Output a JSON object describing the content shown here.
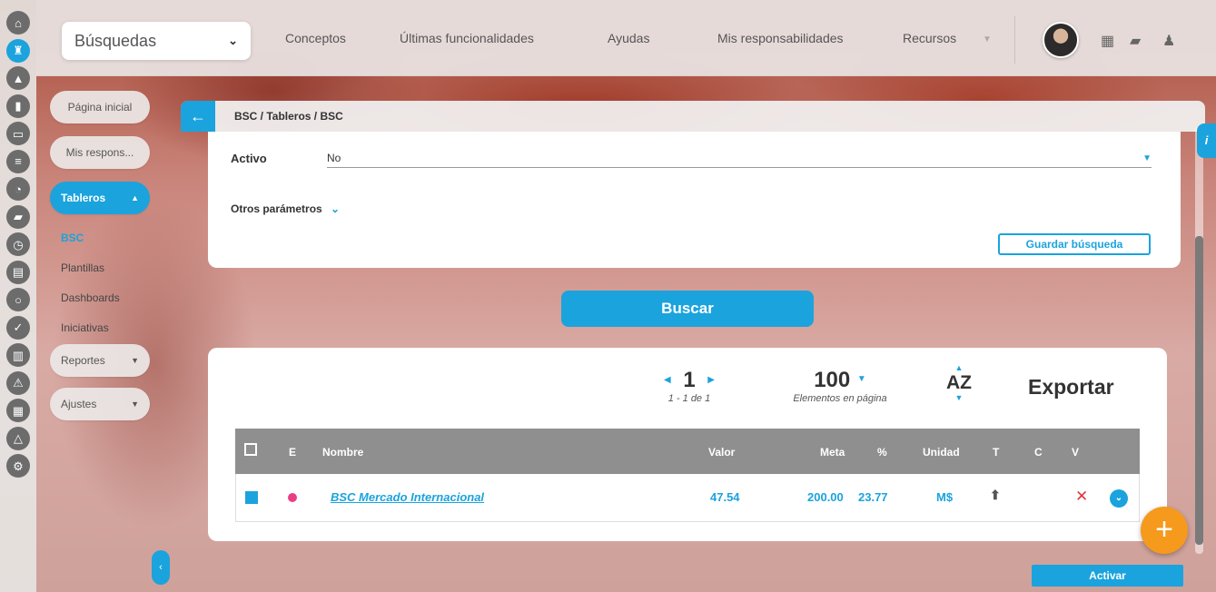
{
  "rail": {
    "icons": [
      "home-icon",
      "chess-rook-icon",
      "triangle-up-icon",
      "bar-chart-icon",
      "presentation-icon",
      "list-icon",
      "pie-chart-icon",
      "briefcase-icon",
      "clock-icon",
      "document-icon",
      "cycle-icon",
      "check-circle-icon",
      "bag-icon",
      "warning-icon",
      "calendar-icon",
      "network-icon",
      "gear-icon"
    ]
  },
  "topbar": {
    "search_select": "Búsquedas",
    "nav": [
      "Conceptos",
      "Últimas funcionalidades",
      "Ayudas",
      "Mis responsabilidades",
      "Recursos"
    ]
  },
  "sidebar": {
    "pagina_inicial": "Página inicial",
    "mis_respons": "Mis respons...",
    "tableros": "Tableros",
    "sub_items": [
      "BSC",
      "Plantillas",
      "Dashboards",
      "Iniciativas"
    ],
    "reportes": "Reportes",
    "ajustes": "Ajustes"
  },
  "panel": {
    "breadcrumb": "BSC / Tableros / BSC",
    "activo_label": "Activo",
    "activo_value": "No",
    "otros_parametros": "Otros parámetros",
    "guardar_busqueda": "Guardar búsqueda",
    "buscar": "Buscar"
  },
  "results": {
    "page": "1",
    "page_range": "1 - 1 de 1",
    "per_page": "100",
    "per_page_label": "Elementos en página",
    "sort": "AZ",
    "exportar": "Exportar",
    "columns": {
      "e": "E",
      "nombre": "Nombre",
      "valor": "Valor",
      "meta": "Meta",
      "pct": "%",
      "unidad": "Unidad",
      "t": "T",
      "c": "C",
      "v": "V"
    },
    "rows": [
      {
        "nombre": "BSC Mercado Internacional",
        "valor": "47.54",
        "meta": "200.00",
        "pct": "23.77",
        "unidad": "M$",
        "status_color": "#ea3e84"
      }
    ]
  },
  "actions": {
    "activar": "Activar"
  },
  "colors": {
    "accent": "#1ba3dd",
    "fab": "#f59a1d",
    "danger": "#e0353b"
  }
}
